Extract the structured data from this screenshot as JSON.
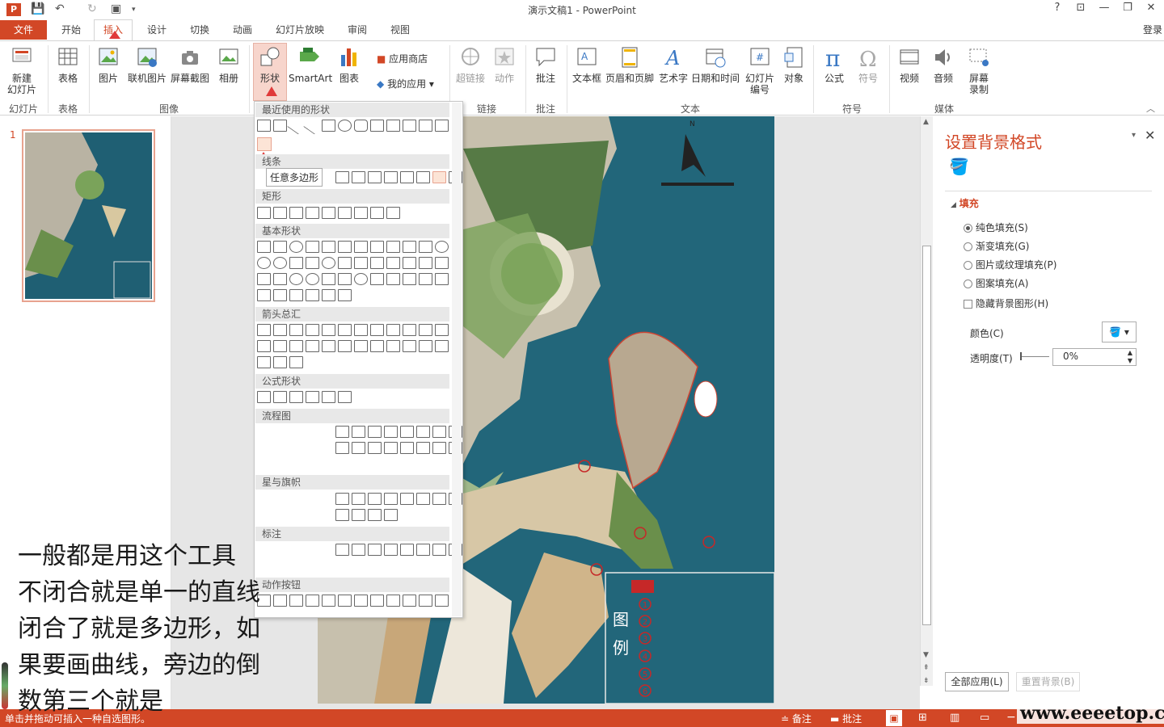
{
  "app": {
    "title": "演示文稿1 - PowerPoint",
    "signin": "登录"
  },
  "window": {
    "help": "?",
    "ribbon_opts": "⊡",
    "minimize": "🗕",
    "restore": "❐",
    "close": "✕"
  },
  "tabs": [
    "文件",
    "开始",
    "插入",
    "设计",
    "切换",
    "动画",
    "幻灯片放映",
    "审阅",
    "视图"
  ],
  "ribbon": {
    "buttons": [
      {
        "label": "新建\n幻灯片",
        "icon": "new-slide-icon"
      },
      {
        "label": "表格",
        "icon": "table-icon"
      },
      {
        "label": "图片",
        "icon": "picture-icon"
      },
      {
        "label": "联机图片",
        "icon": "online-picture-icon"
      },
      {
        "label": "屏幕截图",
        "icon": "screenshot-icon"
      },
      {
        "label": "相册",
        "icon": "album-icon"
      },
      {
        "label": "形状",
        "icon": "shapes-icon"
      },
      {
        "label": "SmartArt",
        "icon": "smartart-icon"
      },
      {
        "label": "图表",
        "icon": "chart-icon"
      },
      {
        "label": "超链接",
        "icon": "hyperlink-icon"
      },
      {
        "label": "动作",
        "icon": "action-icon"
      },
      {
        "label": "批注",
        "icon": "comment-icon"
      },
      {
        "label": "文本框",
        "icon": "textbox-icon"
      },
      {
        "label": "页眉和页脚",
        "icon": "header-footer-icon"
      },
      {
        "label": "艺术字",
        "icon": "wordart-icon"
      },
      {
        "label": "日期和时间",
        "icon": "datetime-icon"
      },
      {
        "label": "幻灯片\n编号",
        "icon": "slide-number-icon"
      },
      {
        "label": "对象",
        "icon": "object-icon"
      },
      {
        "label": "公式",
        "icon": "equation-icon"
      },
      {
        "label": "符号",
        "icon": "symbol-icon"
      },
      {
        "label": "视频",
        "icon": "video-icon"
      },
      {
        "label": "音频",
        "icon": "audio-icon"
      },
      {
        "label": "屏幕\n录制",
        "icon": "screen-record-icon"
      }
    ],
    "store": "应用商店",
    "myapps": "我的应用",
    "groups": [
      "幻灯片",
      "表格",
      "图像",
      "链接",
      "批注",
      "文本",
      "符号",
      "媒体"
    ]
  },
  "shapes_menu": {
    "sections": [
      "最近使用的形状",
      "线条",
      "矩形",
      "基本形状",
      "箭头总汇",
      "公式形状",
      "流程图",
      "星与旗帜",
      "标注",
      "动作按钮"
    ],
    "tooltip": "任意多边形"
  },
  "annotation": "一般都是用这个工具\n不闭合就是单一的直线\n闭合了就是多边形，如\n果要画曲线，旁边的倒\n数第三个就是",
  "slide": {
    "number": "1",
    "legend_title": "图\n例",
    "legend_items": [
      "1",
      "2",
      "3",
      "4",
      "5",
      "6"
    ]
  },
  "format_pane": {
    "title": "设置背景格式",
    "fill_header": "填充",
    "options": [
      "纯色填充(S)",
      "渐变填充(G)",
      "图片或纹理填充(P)",
      "图案填充(A)"
    ],
    "hide_bg": "隐藏背景图形(H)",
    "color_label": "颜色(C)",
    "transparency_label": "透明度(T)",
    "transparency_value": "0%",
    "apply_all": "全部应用(L)",
    "reset": "重置背景(B)"
  },
  "status": {
    "hint": "单击并拖动可插入一种自选图形。",
    "notes": "备注",
    "comments": "批注",
    "watermark": "www.eeeetop.com"
  }
}
